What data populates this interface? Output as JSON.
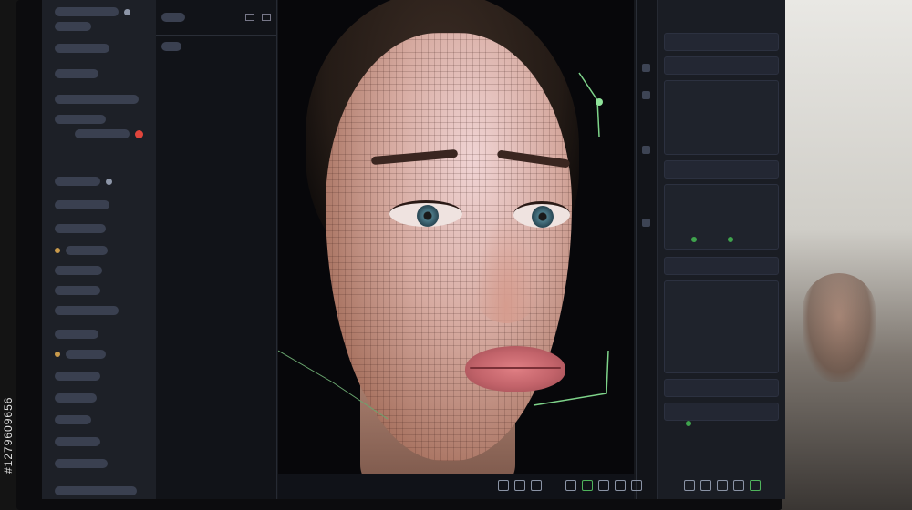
{
  "sidebar": {
    "items": [
      {
        "label": "",
        "indicator": "none"
      },
      {
        "label": "",
        "indicator": "none"
      },
      {
        "label": "",
        "indicator": "none"
      },
      {
        "label": "",
        "indicator": "none"
      },
      {
        "label": "",
        "indicator": "red"
      },
      {
        "label": "",
        "indicator": "none"
      },
      {
        "label": "",
        "indicator": "none"
      },
      {
        "label": "",
        "indicator": "none"
      },
      {
        "label": "",
        "indicator": "amber"
      },
      {
        "label": "",
        "indicator": "amber"
      },
      {
        "label": "",
        "indicator": "none"
      },
      {
        "label": "",
        "indicator": "none"
      },
      {
        "label": "",
        "indicator": "amber"
      },
      {
        "label": "",
        "indicator": "amber"
      },
      {
        "label": "",
        "indicator": "none"
      },
      {
        "label": "",
        "indicator": "none"
      },
      {
        "label": "",
        "indicator": "none"
      },
      {
        "label": "",
        "indicator": "none"
      }
    ]
  },
  "viewport": {
    "subject": "face-wireframe-mesh"
  },
  "colors": {
    "accent_green": "#4fb35c",
    "alert_red": "#e0453c",
    "panel_bg": "#1d2027"
  },
  "watermark": {
    "id_text": "#1279609656"
  },
  "icons": [
    "layers-icon",
    "mesh-icon",
    "camera-icon",
    "render-icon",
    "settings-icon"
  ]
}
